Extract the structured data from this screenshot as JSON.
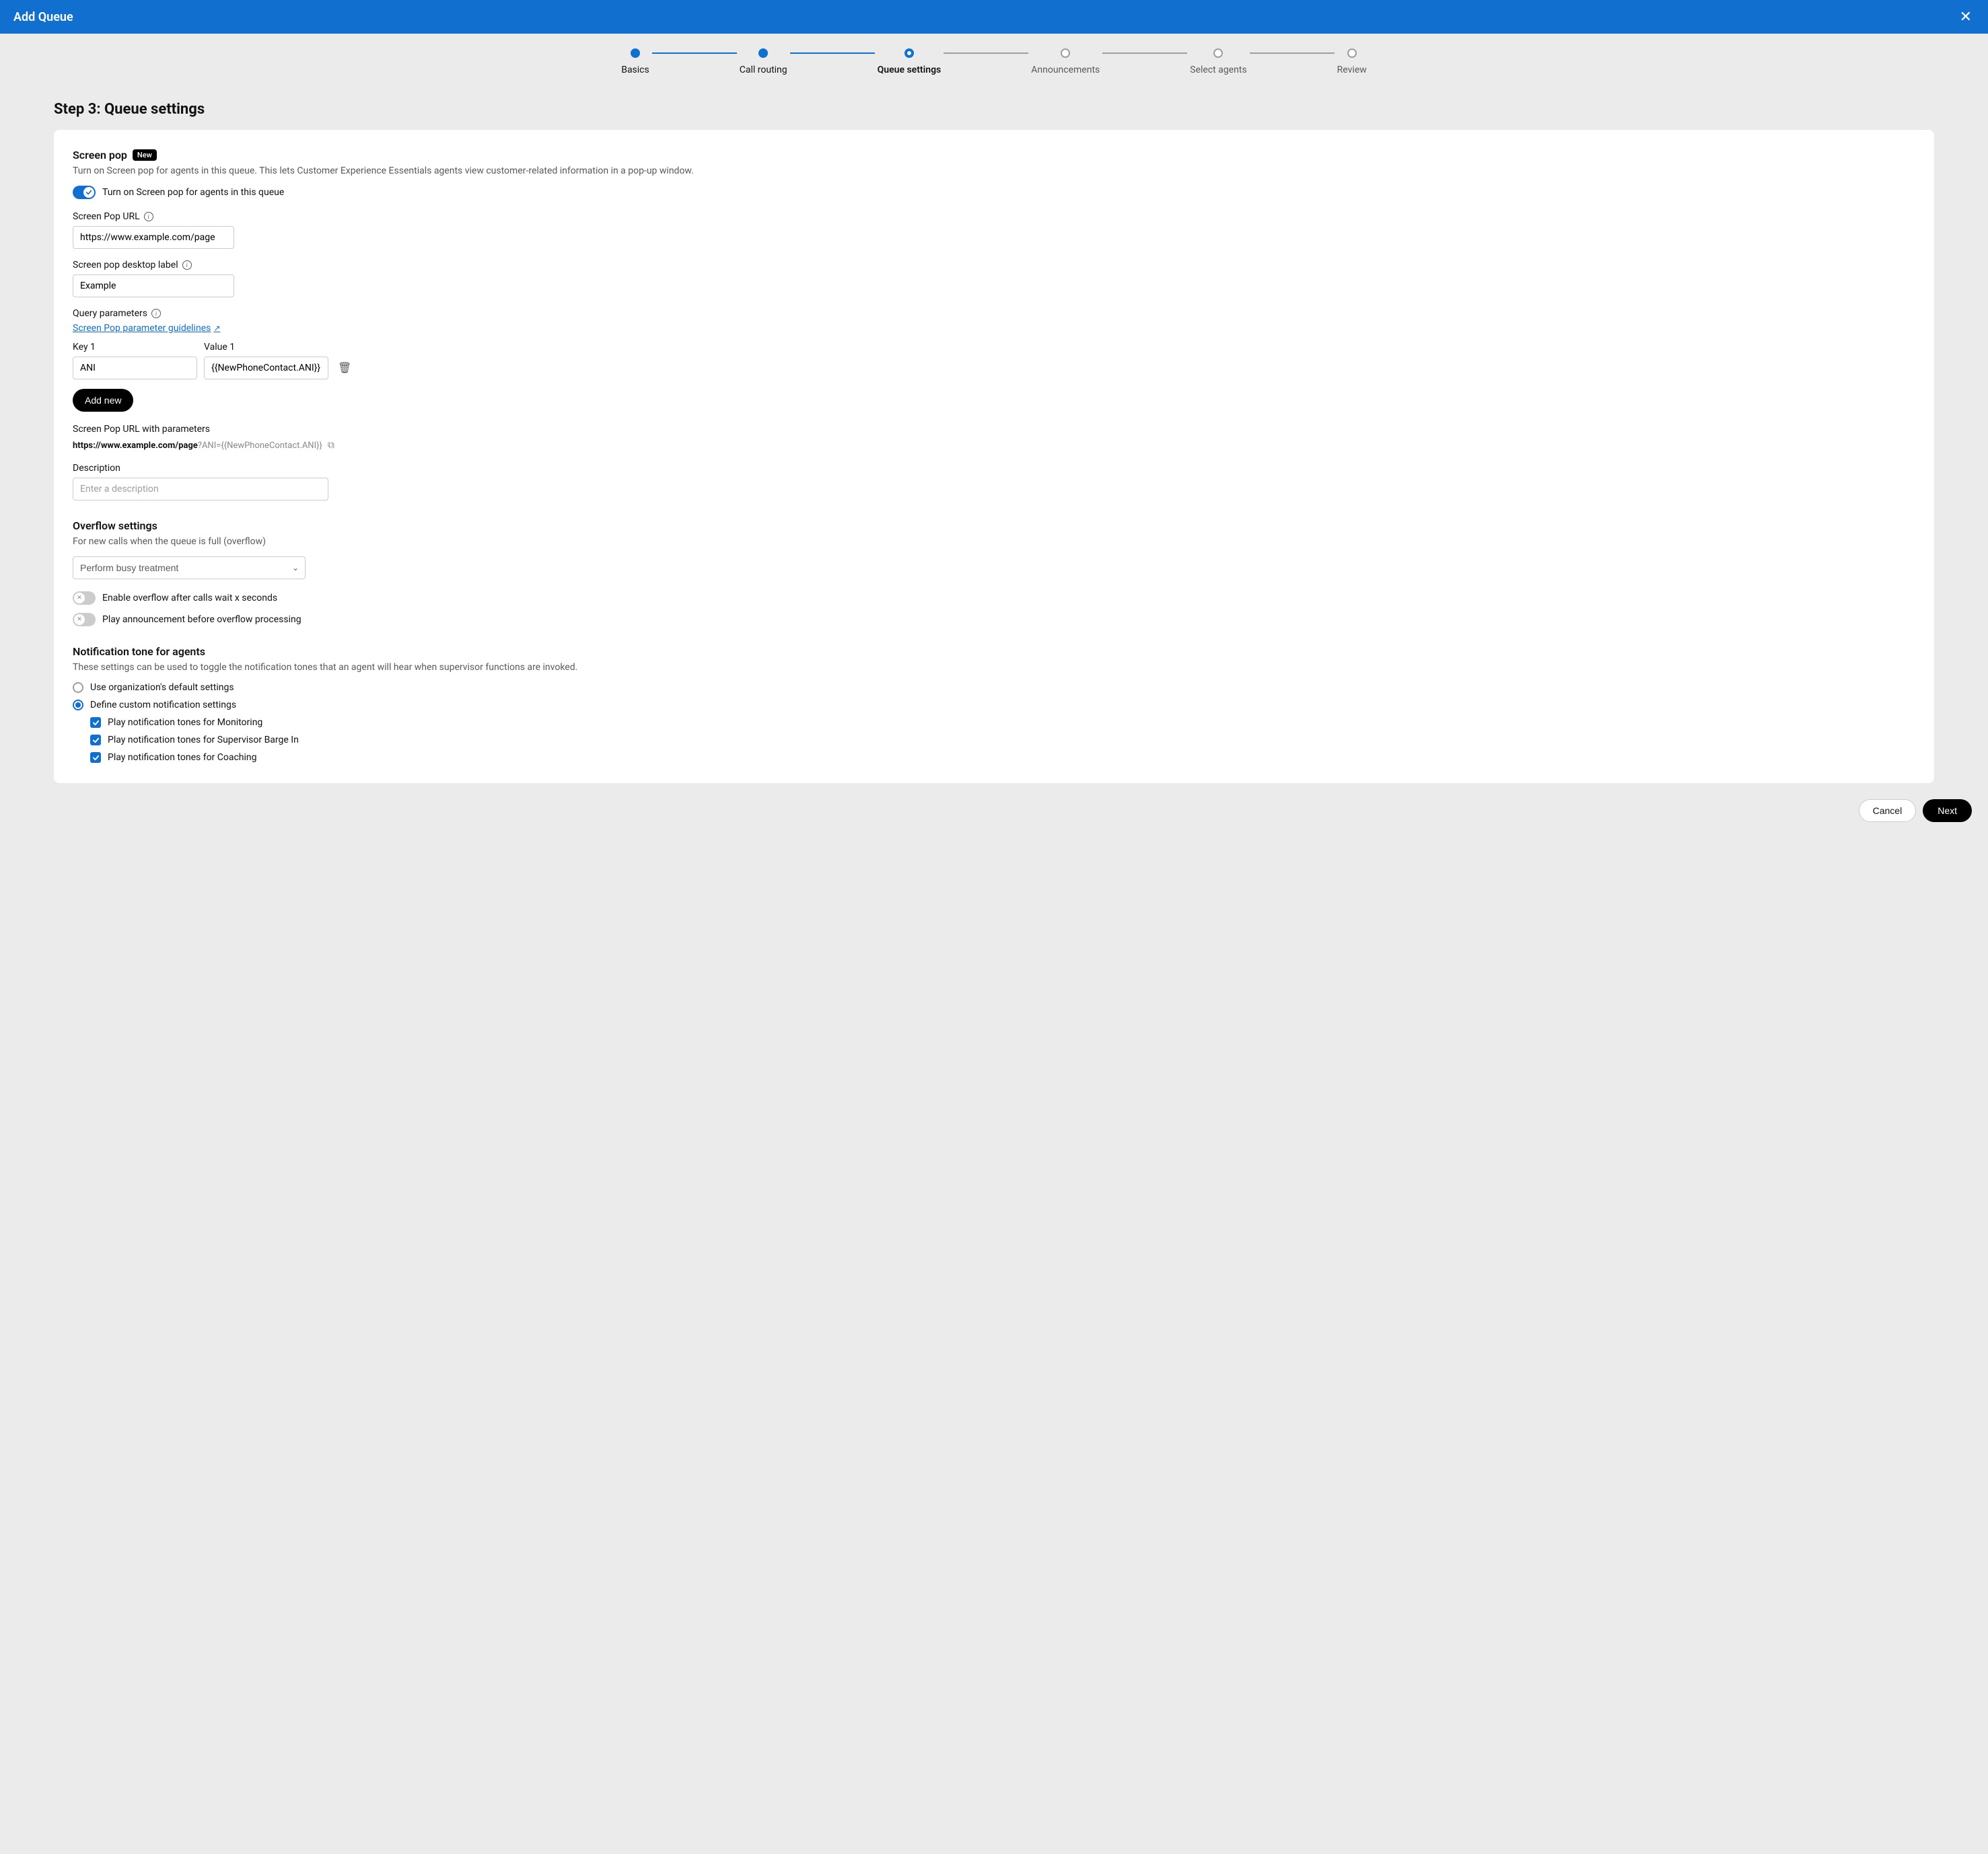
{
  "header": {
    "title": "Add Queue"
  },
  "stepper": {
    "steps": [
      {
        "label": "Basics",
        "state": "done"
      },
      {
        "label": "Call routing",
        "state": "done"
      },
      {
        "label": "Queue settings",
        "state": "current"
      },
      {
        "label": "Announcements",
        "state": "pending"
      },
      {
        "label": "Select agents",
        "state": "pending"
      },
      {
        "label": "Review",
        "state": "pending"
      }
    ]
  },
  "page_title": "Step 3: Queue settings",
  "screen_pop": {
    "title": "Screen pop",
    "badge": "New",
    "desc": "Turn on Screen pop for agents in this queue. This lets Customer Experience Essentials agents view customer-related information in a pop-up window.",
    "toggle_on": true,
    "toggle_label": "Turn on Screen pop for agents in this queue",
    "url_label": "Screen Pop URL",
    "url_value": "https://www.example.com/page",
    "desktop_label_label": "Screen pop desktop label",
    "desktop_label_value": "Example",
    "query_params_label": "Query parameters",
    "guidelines_link": "Screen Pop parameter guidelines",
    "key_label": "Key 1",
    "key_value": "ANI",
    "value_label": "Value 1",
    "value_value": "{{NewPhoneContact.ANI}}",
    "add_new_label": "Add new",
    "preview_label": "Screen Pop URL with parameters",
    "preview_base": "https://www.example.com/page",
    "preview_params": "?ANI={{NewPhoneContact.ANI}}",
    "description_label": "Description",
    "description_placeholder": "Enter a description"
  },
  "overflow": {
    "title": "Overflow settings",
    "desc": "For new calls when the queue is full (overflow)",
    "select_value": "Perform busy treatment",
    "toggle1_label": "Enable overflow after calls wait x seconds",
    "toggle1_on": false,
    "toggle2_label": "Play announcement before overflow processing",
    "toggle2_on": false
  },
  "notification": {
    "title": "Notification tone for agents",
    "desc": "These settings can be used to toggle the notification tones that an agent will hear when supervisor functions are invoked.",
    "radio1_label": "Use organization's default settings",
    "radio2_label": "Define custom notification settings",
    "selected": "custom",
    "cb1_label": "Play notification tones for Monitoring",
    "cb2_label": "Play notification tones for Supervisor Barge In",
    "cb3_label": "Play notification tones for Coaching"
  },
  "footer": {
    "cancel": "Cancel",
    "next": "Next"
  }
}
